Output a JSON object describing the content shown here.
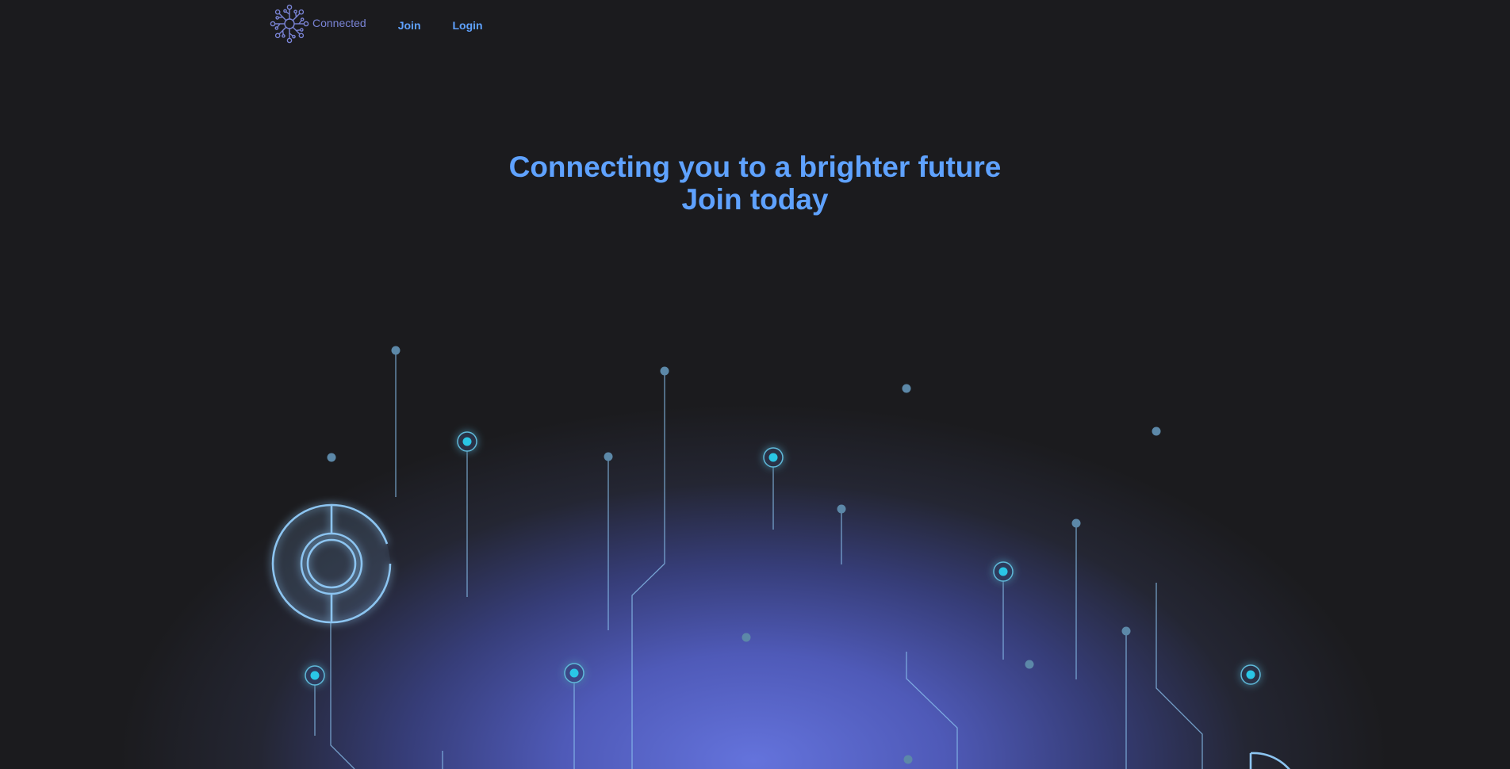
{
  "nav": {
    "brand_name": "Connected",
    "logo_icon": "network-flower-icon",
    "join_label": "Join",
    "login_label": "Login"
  },
  "hero": {
    "line1": "Connecting you to a brighter future",
    "line2": "Join today"
  },
  "colors": {
    "background": "#1b1b1e",
    "accent": "#5fa2ff",
    "brand": "#7a84d6",
    "glow": "#6473dc",
    "node_active": "#29c6e6",
    "node_idle": "#5c88a8",
    "line": "#8cc4f0"
  },
  "decoration": {
    "background_icon": "circuit-board-icon"
  }
}
